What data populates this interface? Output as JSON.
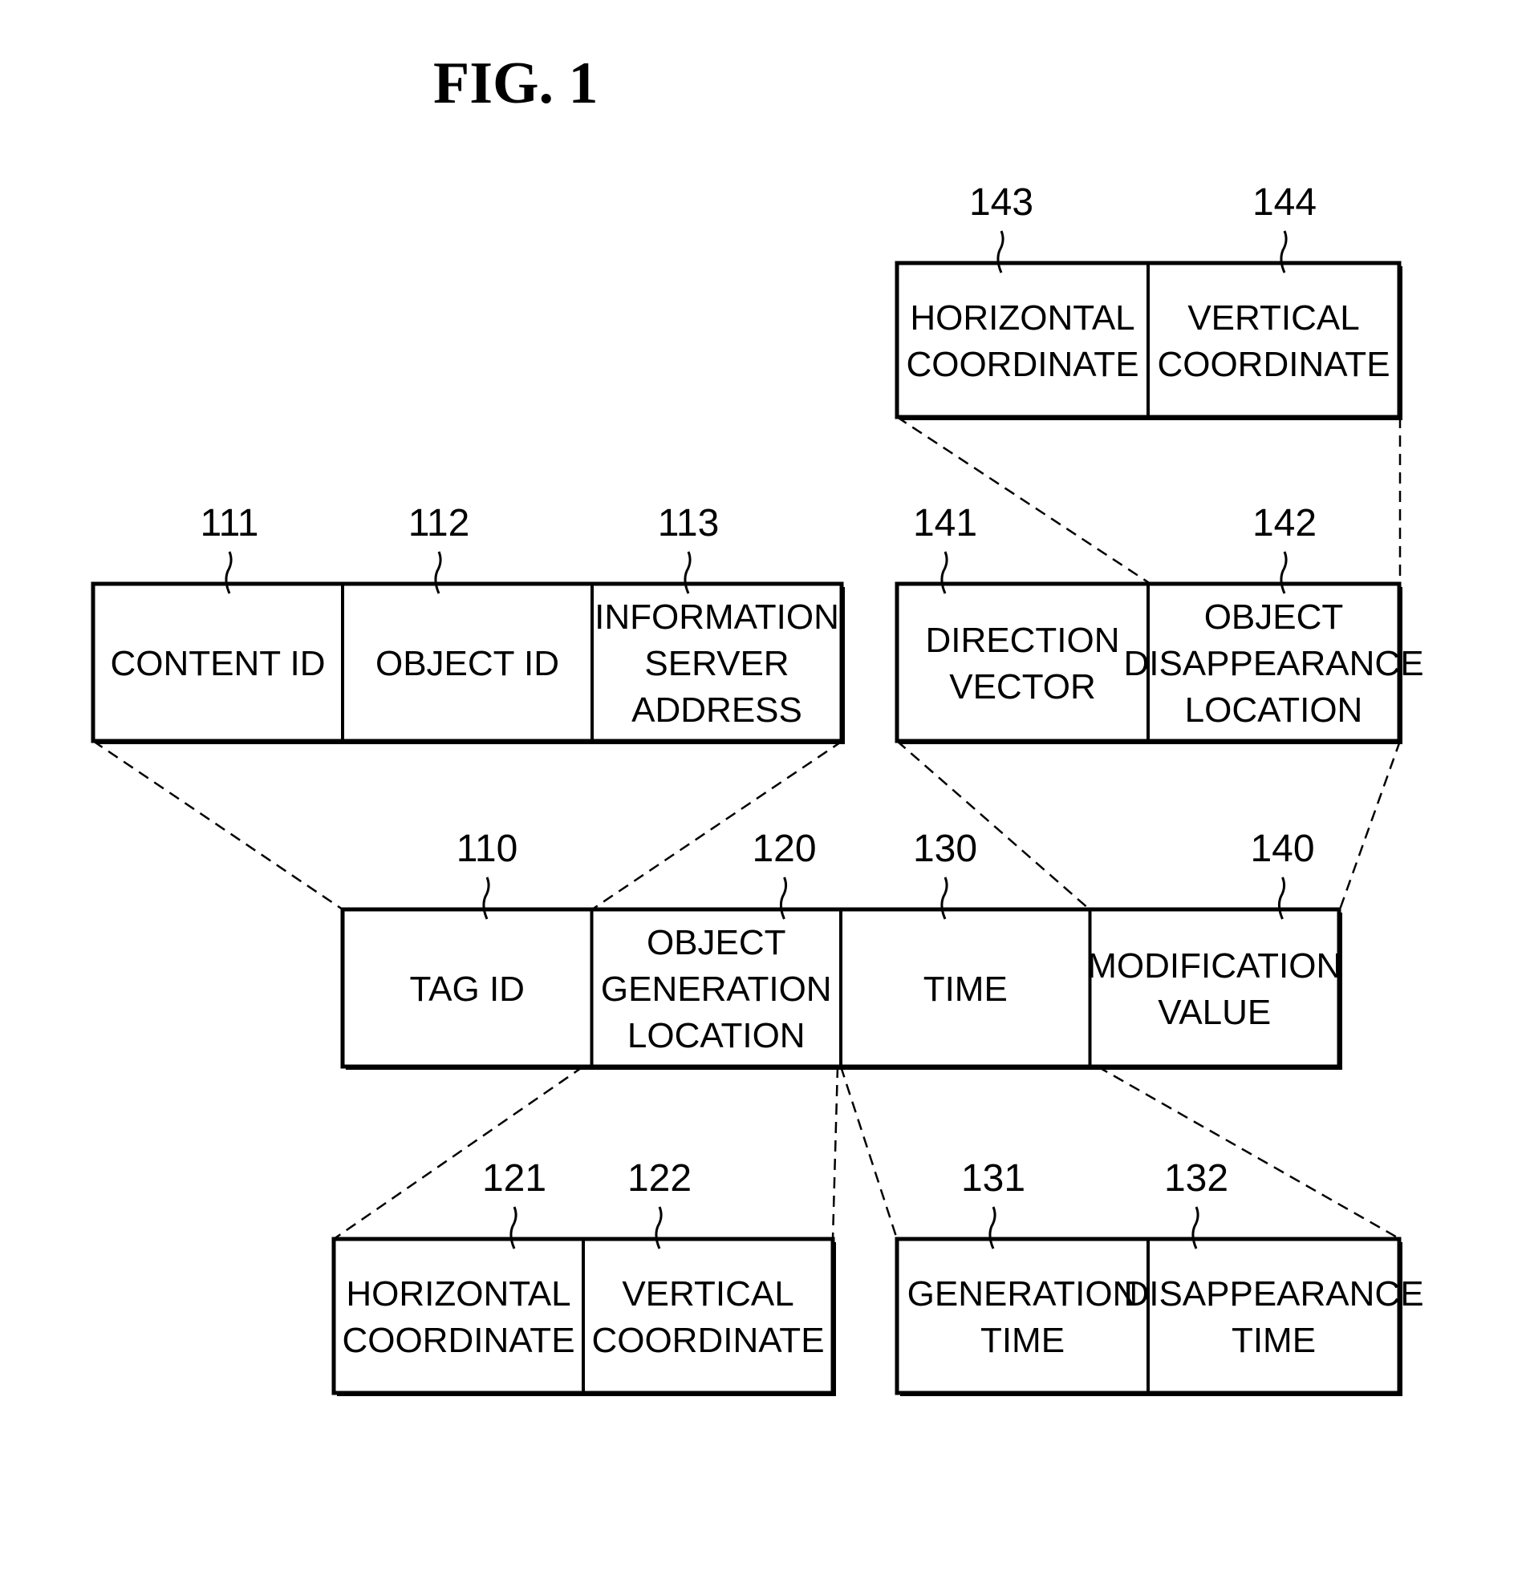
{
  "figure": {
    "title": "FIG. 1"
  },
  "structures": [
    {
      "id": "main",
      "fields": [
        {
          "ref": "110",
          "lines": [
            "TAG ID"
          ]
        },
        {
          "ref": "120",
          "lines": [
            "OBJECT",
            "GENERATION",
            "LOCATION"
          ]
        },
        {
          "ref": "130",
          "lines": [
            "TIME"
          ]
        },
        {
          "ref": "140",
          "lines": [
            "MODIFICATION",
            "VALUE"
          ]
        }
      ]
    },
    {
      "id": "tag-id-detail",
      "expands": "110",
      "fields": [
        {
          "ref": "111",
          "lines": [
            "CONTENT ID"
          ]
        },
        {
          "ref": "112",
          "lines": [
            "OBJECT ID"
          ]
        },
        {
          "ref": "113",
          "lines": [
            "INFORMATION",
            "SERVER",
            "ADDRESS"
          ]
        }
      ]
    },
    {
      "id": "modification-detail",
      "expands": "140",
      "fields": [
        {
          "ref": "141",
          "lines": [
            "DIRECTION",
            "VECTOR"
          ]
        },
        {
          "ref": "142",
          "lines": [
            "OBJECT",
            "DISAPPEARANCE",
            "LOCATION"
          ]
        }
      ]
    },
    {
      "id": "disappearance-location-detail",
      "expands": "142",
      "fields": [
        {
          "ref": "143",
          "lines": [
            "HORIZONTAL",
            "COORDINATE"
          ]
        },
        {
          "ref": "144",
          "lines": [
            "VERTICAL",
            "COORDINATE"
          ]
        }
      ]
    },
    {
      "id": "generation-location-detail",
      "expands": "120",
      "fields": [
        {
          "ref": "121",
          "lines": [
            "HORIZONTAL",
            "COORDINATE"
          ]
        },
        {
          "ref": "122",
          "lines": [
            "VERTICAL",
            "COORDINATE"
          ]
        }
      ]
    },
    {
      "id": "time-detail",
      "expands": "130",
      "fields": [
        {
          "ref": "131",
          "lines": [
            "GENERATION",
            "TIME"
          ]
        },
        {
          "ref": "132",
          "lines": [
            "DISAPPEARANCE",
            "TIME"
          ]
        }
      ]
    }
  ]
}
